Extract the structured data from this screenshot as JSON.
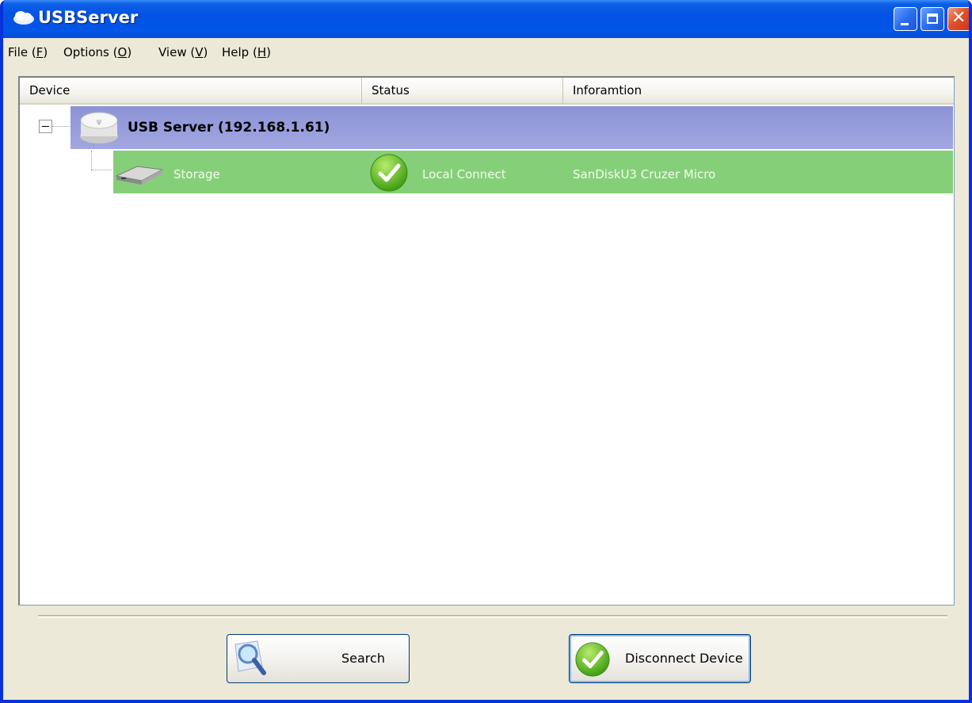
{
  "window": {
    "title": "USBServer"
  },
  "menu": [
    {
      "label": "File (",
      "key": "F",
      "end": ")"
    },
    {
      "label": "Options (",
      "key": "O",
      "end": ")"
    },
    {
      "label": "View (",
      "key": "V",
      "end": ")"
    },
    {
      "label": "Help (",
      "key": "H",
      "end": ")"
    }
  ],
  "list": {
    "columns": [
      "Device",
      "Status",
      "Inforamtion"
    ],
    "server": {
      "label": "USB Server  (192.168.1.61)",
      "icon": "usb-server-icon",
      "row_color": "#9ea3de"
    },
    "devices": [
      {
        "name": "Storage",
        "status": "Local  Connect",
        "info": "SanDiskU3 Cruzer Micro",
        "icon": "hard-drive-icon",
        "status_icon": "green-check-icon",
        "row_color": "#86cf79"
      }
    ]
  },
  "buttons": {
    "search": "Search",
    "disconnect": "Disconnect Device"
  },
  "colors": {
    "titlebar": "#0353e4",
    "frame": "#0831d9",
    "dialog_bg": "#ece9d8"
  }
}
